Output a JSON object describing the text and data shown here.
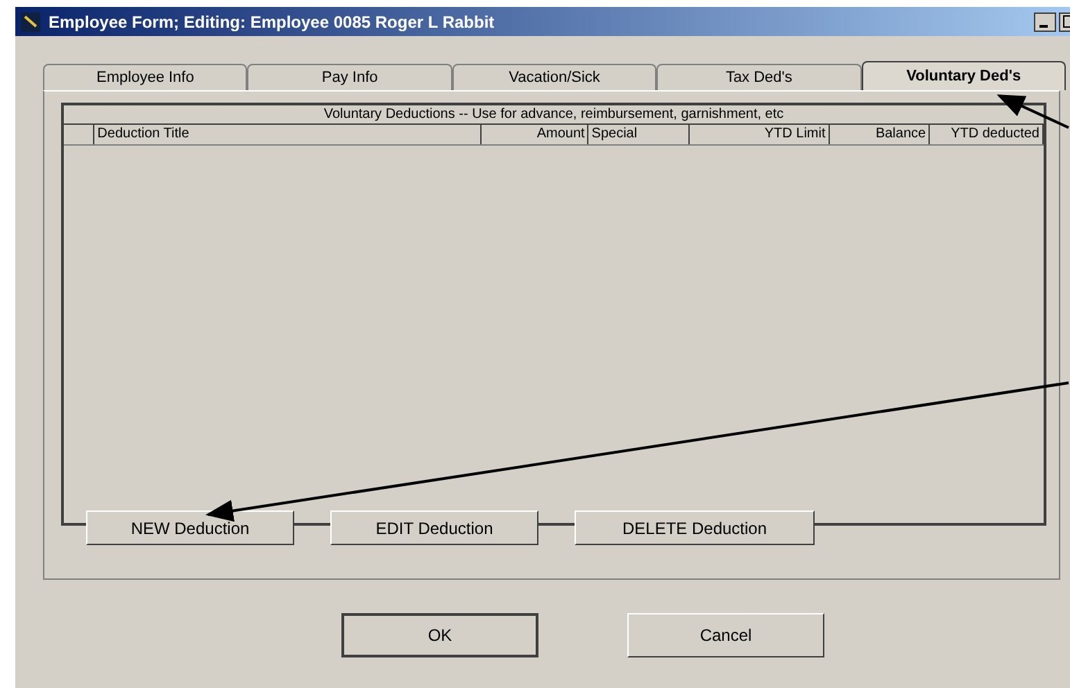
{
  "window": {
    "title": "Employee Form; Editing: Employee 0085 Roger L Rabbit"
  },
  "tabs": [
    {
      "label": "Employee Info",
      "selected": false
    },
    {
      "label": "Pay Info",
      "selected": false
    },
    {
      "label": "Vacation/Sick",
      "selected": false
    },
    {
      "label": "Tax Ded's",
      "selected": false
    },
    {
      "label": "Voluntary Ded's",
      "selected": true
    }
  ],
  "table": {
    "caption": "Voluntary Deductions -- Use for advance, reimbursement, garnishment, etc",
    "columns": [
      "Deduction Title",
      "Amount",
      "Special",
      "YTD Limit",
      "Balance",
      "YTD deducted"
    ]
  },
  "actions": [
    "NEW Deduction",
    "EDIT Deduction",
    "DELETE Deduction"
  ],
  "buttons": [
    {
      "label": "OK",
      "default": true
    },
    {
      "label": "Cancel",
      "default": false
    }
  ]
}
